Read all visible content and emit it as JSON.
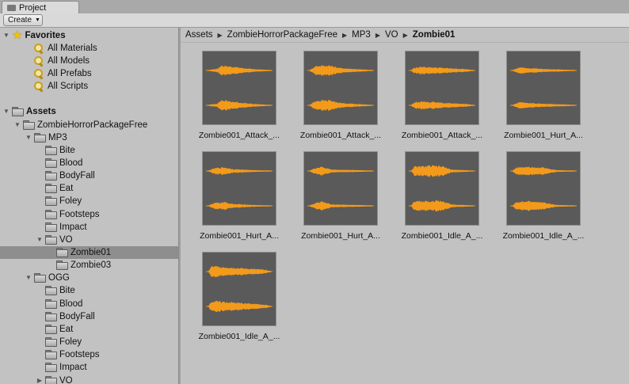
{
  "window": {
    "tab_label": "Project",
    "create_label": "Create"
  },
  "tree": [
    {
      "label": "Favorites",
      "depth": 0,
      "icon": "star-icon",
      "bold": true,
      "expanded": true,
      "selected": false
    },
    {
      "label": "All Materials",
      "depth": 2,
      "icon": "search-icon",
      "bold": false,
      "expanded": null,
      "selected": false
    },
    {
      "label": "All Models",
      "depth": 2,
      "icon": "search-icon",
      "bold": false,
      "expanded": null,
      "selected": false
    },
    {
      "label": "All Prefabs",
      "depth": 2,
      "icon": "search-icon",
      "bold": false,
      "expanded": null,
      "selected": false
    },
    {
      "label": "All Scripts",
      "depth": 2,
      "icon": "search-icon",
      "bold": false,
      "expanded": null,
      "selected": false
    },
    {
      "label": "",
      "depth": 0,
      "icon": "",
      "bold": false,
      "expanded": null,
      "selected": false,
      "spacer": true
    },
    {
      "label": "Assets",
      "depth": 0,
      "icon": "folder-icon",
      "bold": true,
      "expanded": true,
      "selected": false
    },
    {
      "label": "ZombieHorrorPackageFree",
      "depth": 1,
      "icon": "folder-icon",
      "bold": false,
      "expanded": true,
      "selected": false
    },
    {
      "label": "MP3",
      "depth": 2,
      "icon": "folder-icon",
      "bold": false,
      "expanded": true,
      "selected": false
    },
    {
      "label": "Bite",
      "depth": 3,
      "icon": "folder-icon",
      "bold": false,
      "expanded": null,
      "selected": false
    },
    {
      "label": "Blood",
      "depth": 3,
      "icon": "folder-icon",
      "bold": false,
      "expanded": null,
      "selected": false
    },
    {
      "label": "BodyFall",
      "depth": 3,
      "icon": "folder-icon",
      "bold": false,
      "expanded": null,
      "selected": false
    },
    {
      "label": "Eat",
      "depth": 3,
      "icon": "folder-icon",
      "bold": false,
      "expanded": null,
      "selected": false
    },
    {
      "label": "Foley",
      "depth": 3,
      "icon": "folder-icon",
      "bold": false,
      "expanded": null,
      "selected": false
    },
    {
      "label": "Footsteps",
      "depth": 3,
      "icon": "folder-icon",
      "bold": false,
      "expanded": null,
      "selected": false
    },
    {
      "label": "Impact",
      "depth": 3,
      "icon": "folder-icon",
      "bold": false,
      "expanded": null,
      "selected": false
    },
    {
      "label": "VO",
      "depth": 3,
      "icon": "folder-icon",
      "bold": false,
      "expanded": true,
      "selected": false
    },
    {
      "label": "Zombie01",
      "depth": 4,
      "icon": "folder-icon",
      "bold": false,
      "expanded": null,
      "selected": true
    },
    {
      "label": "Zombie03",
      "depth": 4,
      "icon": "folder-icon",
      "bold": false,
      "expanded": null,
      "selected": false
    },
    {
      "label": "OGG",
      "depth": 2,
      "icon": "folder-icon",
      "bold": false,
      "expanded": true,
      "selected": false
    },
    {
      "label": "Bite",
      "depth": 3,
      "icon": "folder-icon",
      "bold": false,
      "expanded": null,
      "selected": false
    },
    {
      "label": "Blood",
      "depth": 3,
      "icon": "folder-icon",
      "bold": false,
      "expanded": null,
      "selected": false
    },
    {
      "label": "BodyFall",
      "depth": 3,
      "icon": "folder-icon",
      "bold": false,
      "expanded": null,
      "selected": false
    },
    {
      "label": "Eat",
      "depth": 3,
      "icon": "folder-icon",
      "bold": false,
      "expanded": null,
      "selected": false
    },
    {
      "label": "Foley",
      "depth": 3,
      "icon": "folder-icon",
      "bold": false,
      "expanded": null,
      "selected": false
    },
    {
      "label": "Footsteps",
      "depth": 3,
      "icon": "folder-icon",
      "bold": false,
      "expanded": null,
      "selected": false
    },
    {
      "label": "Impact",
      "depth": 3,
      "icon": "folder-icon",
      "bold": false,
      "expanded": null,
      "selected": false
    },
    {
      "label": "VO",
      "depth": 3,
      "icon": "folder-icon",
      "bold": false,
      "expanded": false,
      "selected": false
    }
  ],
  "breadcrumb": [
    "Assets",
    "ZombieHorrorPackageFree",
    "MP3",
    "VO",
    "Zombie01"
  ],
  "assets": [
    {
      "name": "Zombie001_Attack_...",
      "shape": "a"
    },
    {
      "name": "Zombie001_Attack_...",
      "shape": "b"
    },
    {
      "name": "Zombie001_Attack_...",
      "shape": "c"
    },
    {
      "name": "Zombie001_Hurt_A...",
      "shape": "d"
    },
    {
      "name": "Zombie001_Hurt_A...",
      "shape": "e"
    },
    {
      "name": "Zombie001_Hurt_A...",
      "shape": "f"
    },
    {
      "name": "Zombie001_Idle_A_...",
      "shape": "g"
    },
    {
      "name": "Zombie001_Idle_A_...",
      "shape": "h"
    },
    {
      "name": "Zombie001_Idle_A_...",
      "shape": "i"
    }
  ],
  "colors": {
    "waveform": "#f39a1a",
    "thumb_bg": "#5a5a5a",
    "selection": "#8e8e8e"
  }
}
